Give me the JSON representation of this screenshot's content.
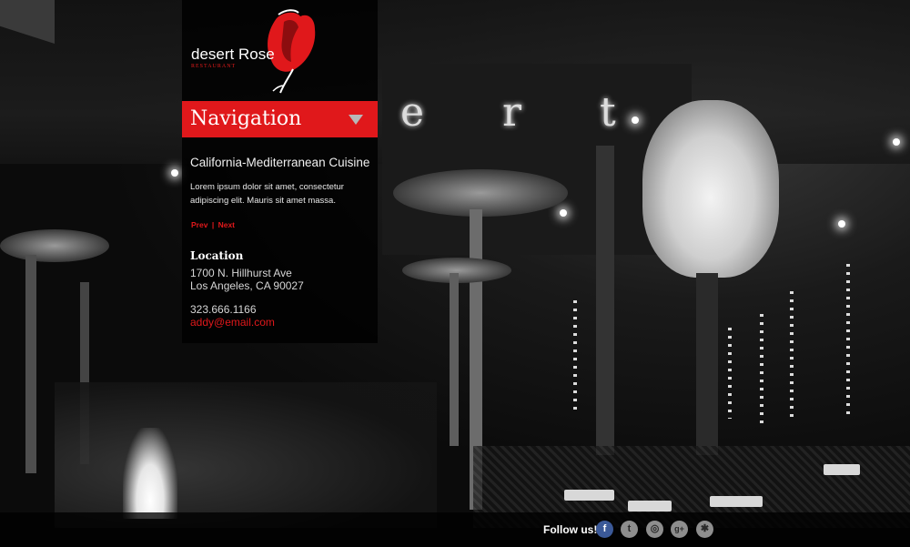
{
  "brand": {
    "name": "desert Rose",
    "tagline": "RESTAURANT",
    "accent_color": "#e0181b"
  },
  "navigation": {
    "label": "Navigation",
    "toggle_icon": "triangle-down-icon"
  },
  "feature": {
    "title": "California-Mediterranean Cuisine",
    "description": "Lorem ipsum dolor sit amet, consectetur adipiscing elit. Mauris sit amet massa.",
    "prev_label": "Prev",
    "separator": "|",
    "next_label": "Next"
  },
  "location": {
    "heading": "Location",
    "address_line1": "1700 N. Hillhurst Ave",
    "address_line2": "Los Angeles, CA 90027",
    "phone": "323.666.1166",
    "email": "addy@email.com"
  },
  "background": {
    "sign_text": "e r t"
  },
  "footer": {
    "follow_label": "Follow us!",
    "social": [
      {
        "name": "facebook-icon",
        "glyph": "f"
      },
      {
        "name": "twitter-icon",
        "glyph": "t"
      },
      {
        "name": "instagram-icon",
        "glyph": "◎"
      },
      {
        "name": "google-plus-icon",
        "glyph": "g+"
      },
      {
        "name": "yelp-icon",
        "glyph": "✱"
      }
    ]
  }
}
